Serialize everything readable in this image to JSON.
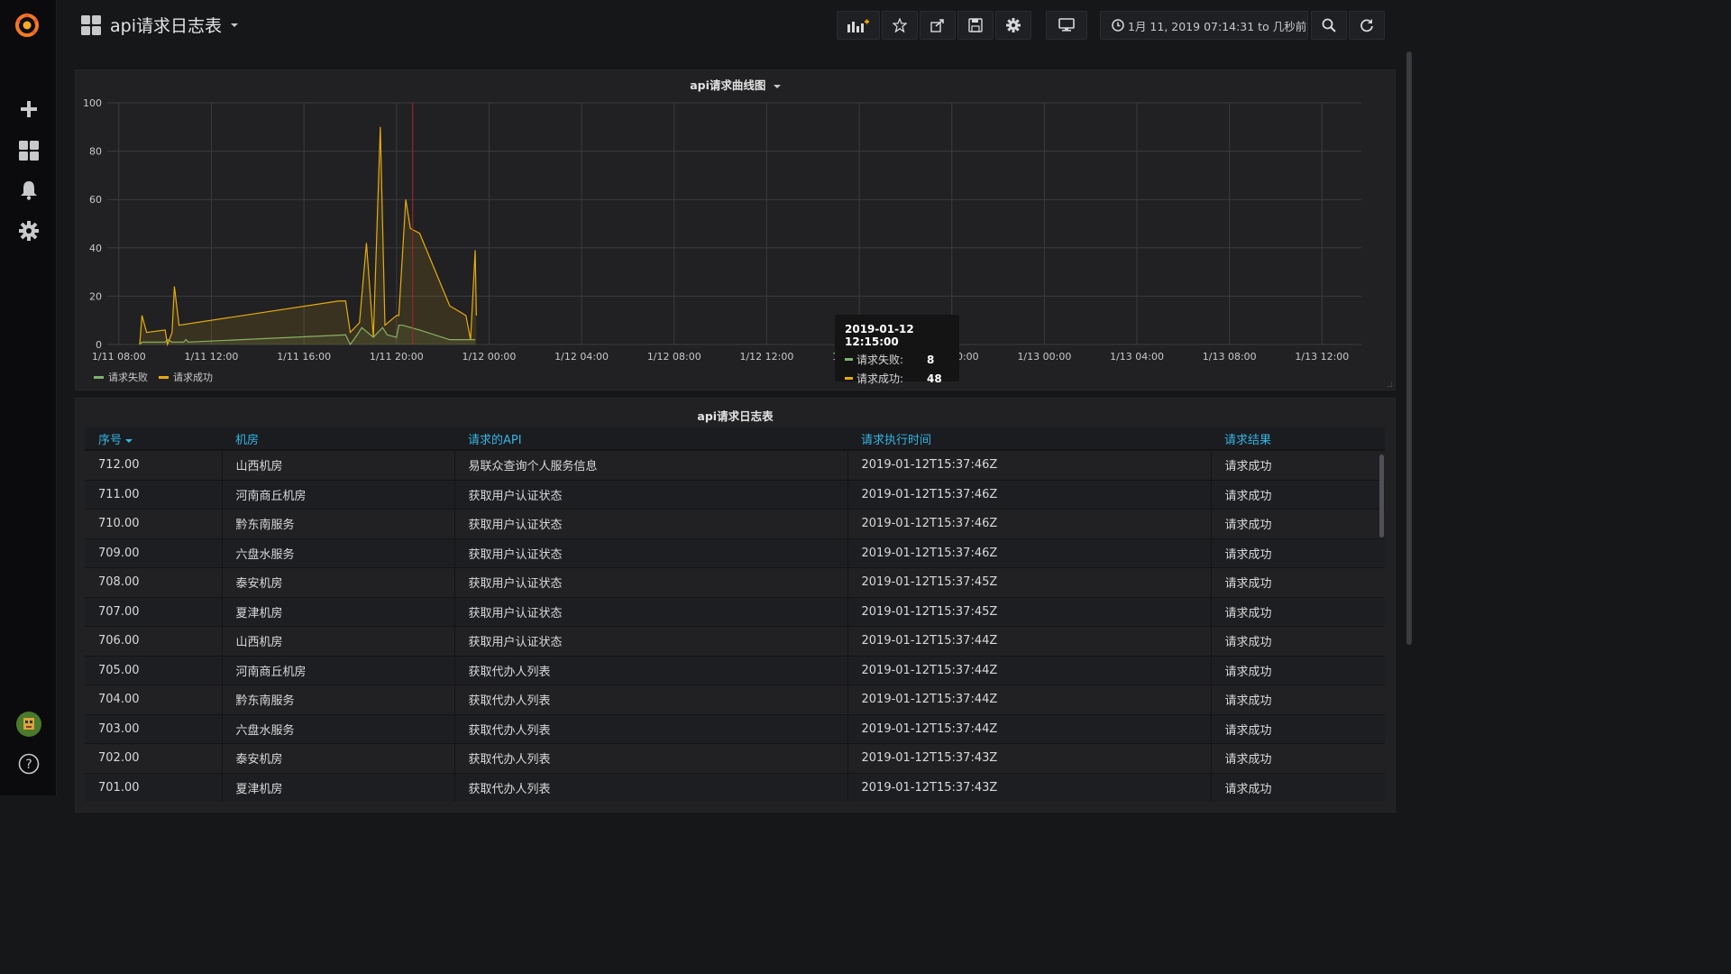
{
  "dashboard": {
    "title": "api请求日志表"
  },
  "timepicker": {
    "range": "1月 11, 2019 07:14:31 to 几秒前"
  },
  "graph_panel": {
    "title": "api请求曲线图"
  },
  "chart_data": {
    "type": "line",
    "title": "api请求曲线图",
    "x_ticks": [
      "1/11 08:00",
      "1/11 12:00",
      "1/11 16:00",
      "1/11 20:00",
      "1/12 00:00",
      "1/12 04:00",
      "1/12 08:00",
      "1/12 12:00",
      "1/12 16:00",
      "1/12 20:00",
      "1/13 00:00",
      "1/13 04:00",
      "1/13 08:00",
      "1/13 12:00"
    ],
    "y_ticks": [
      0,
      20,
      40,
      60,
      80,
      100
    ],
    "ylim": [
      0,
      100
    ],
    "xlim_hours": [
      -0.5,
      53.7
    ],
    "grid": true,
    "legend_position": "bottom-left",
    "series": [
      {
        "name": "请求失败",
        "color": "#7eb26d",
        "points": [
          [
            0.9,
            0
          ],
          [
            1.0,
            1
          ],
          [
            2.0,
            1
          ],
          [
            2.1,
            2
          ],
          [
            2.3,
            1
          ],
          [
            2.8,
            1
          ],
          [
            2.9,
            2
          ],
          [
            3.0,
            1
          ],
          [
            9.8,
            4
          ],
          [
            10.0,
            0
          ],
          [
            10.3,
            4
          ],
          [
            10.5,
            7
          ],
          [
            11.0,
            3
          ],
          [
            11.4,
            7
          ],
          [
            11.6,
            4
          ],
          [
            12.0,
            3
          ],
          [
            12.1,
            8
          ],
          [
            12.25,
            8
          ],
          [
            13.0,
            6
          ],
          [
            14.3,
            2
          ],
          [
            15.4,
            2
          ]
        ]
      },
      {
        "name": "请求成功",
        "color": "#e5ac0e",
        "points": [
          [
            0.9,
            0
          ],
          [
            1.0,
            12
          ],
          [
            1.2,
            5
          ],
          [
            2.0,
            6
          ],
          [
            2.1,
            0
          ],
          [
            2.3,
            5
          ],
          [
            2.4,
            24
          ],
          [
            2.6,
            8
          ],
          [
            9.5,
            18
          ],
          [
            9.8,
            18
          ],
          [
            10.0,
            5
          ],
          [
            10.4,
            9
          ],
          [
            10.7,
            42
          ],
          [
            11.0,
            3
          ],
          [
            11.3,
            90
          ],
          [
            11.5,
            8
          ],
          [
            12.0,
            12
          ],
          [
            12.1,
            12
          ],
          [
            12.4,
            60
          ],
          [
            12.6,
            48
          ],
          [
            13.0,
            46
          ],
          [
            14.3,
            16
          ],
          [
            15.0,
            12
          ],
          [
            15.2,
            2
          ],
          [
            15.4,
            39
          ],
          [
            15.45,
            12
          ]
        ]
      }
    ],
    "tooltip": {
      "time": "2019-01-12 12:15:00",
      "values": [
        8,
        48
      ]
    }
  },
  "legend": [
    {
      "label": "请求失败",
      "color": "#7eb26d"
    },
    {
      "label": "请求成功",
      "color": "#e5ac0e"
    }
  ],
  "tooltip": {
    "time": "2019-01-12 12:15:00",
    "rows": [
      {
        "label": "请求失败:",
        "value": "8",
        "color": "#7eb26d"
      },
      {
        "label": "请求成功:",
        "value": "48",
        "color": "#e5ac0e"
      }
    ]
  },
  "table_panel": {
    "title": "api请求日志表",
    "columns": [
      "序号",
      "机房",
      "请求的API",
      "请求执行时间",
      "请求结果"
    ],
    "rows": [
      [
        "712.00",
        "山西机房",
        "易联众查询个人服务信息",
        "2019-01-12T15:37:46Z",
        "请求成功"
      ],
      [
        "711.00",
        "河南商丘机房",
        "获取用户认证状态",
        "2019-01-12T15:37:46Z",
        "请求成功"
      ],
      [
        "710.00",
        "黔东南服务",
        "获取用户认证状态",
        "2019-01-12T15:37:46Z",
        "请求成功"
      ],
      [
        "709.00",
        "六盘水服务",
        "获取用户认证状态",
        "2019-01-12T15:37:46Z",
        "请求成功"
      ],
      [
        "708.00",
        "泰安机房",
        "获取用户认证状态",
        "2019-01-12T15:37:45Z",
        "请求成功"
      ],
      [
        "707.00",
        "夏津机房",
        "获取用户认证状态",
        "2019-01-12T15:37:45Z",
        "请求成功"
      ],
      [
        "706.00",
        "山西机房",
        "获取用户认证状态",
        "2019-01-12T15:37:44Z",
        "请求成功"
      ],
      [
        "705.00",
        "河南商丘机房",
        "获取代办人列表",
        "2019-01-12T15:37:44Z",
        "请求成功"
      ],
      [
        "704.00",
        "黔东南服务",
        "获取代办人列表",
        "2019-01-12T15:37:44Z",
        "请求成功"
      ],
      [
        "703.00",
        "六盘水服务",
        "获取代办人列表",
        "2019-01-12T15:37:44Z",
        "请求成功"
      ],
      [
        "702.00",
        "泰安机房",
        "获取代办人列表",
        "2019-01-12T15:37:43Z",
        "请求成功"
      ],
      [
        "701.00",
        "夏津机房",
        "获取代办人列表",
        "2019-01-12T15:37:43Z",
        "请求成功"
      ]
    ]
  }
}
